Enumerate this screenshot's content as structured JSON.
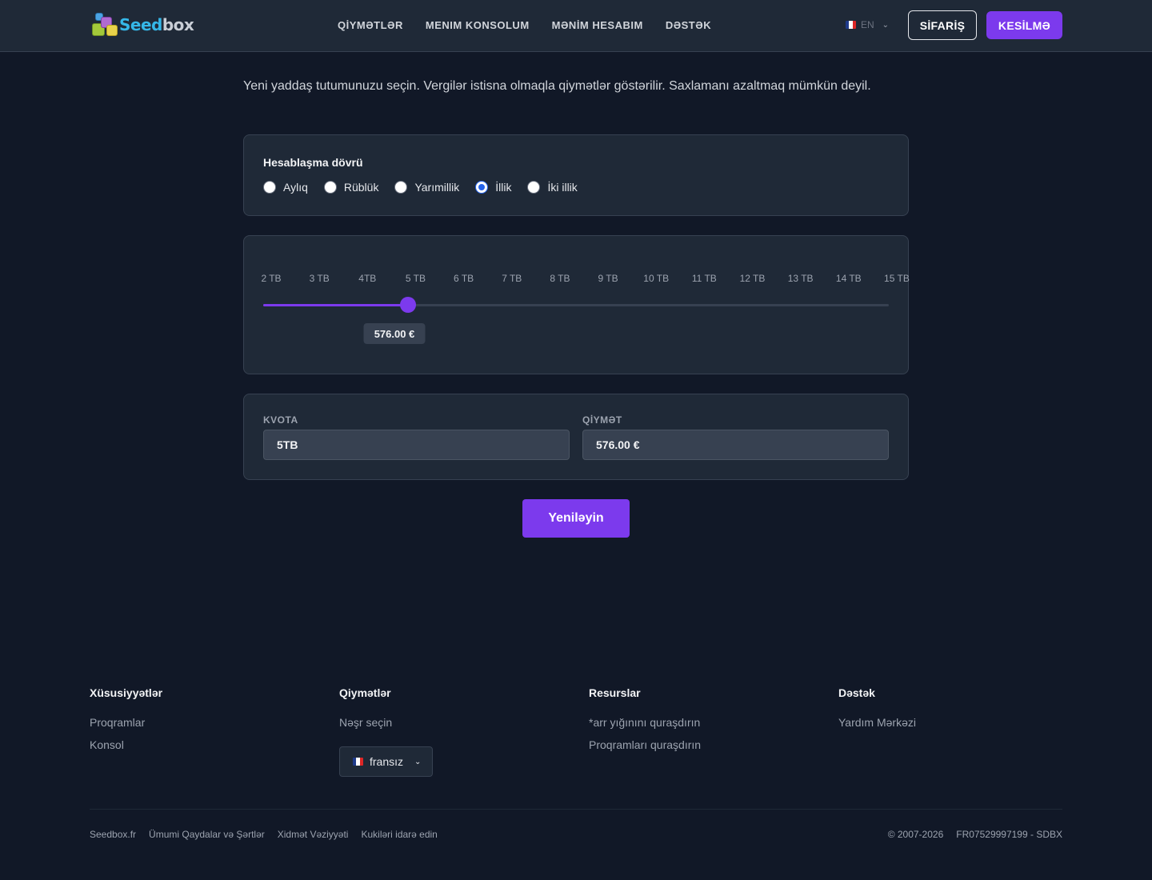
{
  "brand": {
    "name_part1": "Seed",
    "name_part2": "box"
  },
  "nav": {
    "items": [
      {
        "label": "QİYMƏTLƏR"
      },
      {
        "label": "MENIM KONSOLUM"
      },
      {
        "label": "MƏNİM HESABIM"
      },
      {
        "label": "DƏSTƏK"
      }
    ]
  },
  "header": {
    "language": "EN",
    "order_button": "SİFARİŞ",
    "logout_button": "KESİLMƏ"
  },
  "intro": "Yeni yaddaş tutumunuzu seçin. Vergilər istisna olmaqla qiymətlər göstərilir. Saxlamanı azaltmaq mümkün deyil.",
  "billing": {
    "title": "Hesablaşma dövrü",
    "options": [
      {
        "label": "Aylıq",
        "checked": false
      },
      {
        "label": "Rüblük",
        "checked": false
      },
      {
        "label": "Yarımillik",
        "checked": false
      },
      {
        "label": "İllik",
        "checked": true
      },
      {
        "label": "İki illik",
        "checked": false
      }
    ]
  },
  "slider": {
    "ticks": [
      "2 TB",
      "3 TB",
      "4TB",
      "5 TB",
      "6 TB",
      "7 TB",
      "8 TB",
      "9 TB",
      "10 TB",
      "11 TB",
      "12 TB",
      "13 TB",
      "14 TB",
      "15 TB"
    ],
    "selected_index": 3,
    "price_label": "576.00 €"
  },
  "fields": {
    "quota_label": "KVOTA",
    "quota_value": "5TB",
    "price_label": "QİYMƏT",
    "price_value": "576.00 €"
  },
  "update_button": "Yeniləyin",
  "footer": {
    "columns": [
      {
        "title": "Xüsusiyyətlər",
        "links": [
          "Proqramlar",
          "Konsol"
        ]
      },
      {
        "title": "Qiymətlər",
        "links": [
          "Nəşr seçin"
        ]
      },
      {
        "title": "Resurslar",
        "links": [
          "*arr yığınını quraşdırın",
          "Proqramları quraşdırın"
        ]
      },
      {
        "title": "Dəstək",
        "links": [
          "Yardım Mərkəzi"
        ]
      }
    ],
    "language_select": "fransız",
    "bottom_links": [
      "Seedbox.fr",
      "Ümumi Qaydalar və Şərtlər",
      "Xidmət Vəziyyəti",
      "Kukiləri idarə edin"
    ],
    "copyright": "© 2007-2026",
    "company_id": "FR07529997199 - SDBX"
  },
  "colors": {
    "accent": "#7c3aed",
    "background": "#111827",
    "surface": "#1f2937",
    "radio_checked": "#2563eb"
  }
}
